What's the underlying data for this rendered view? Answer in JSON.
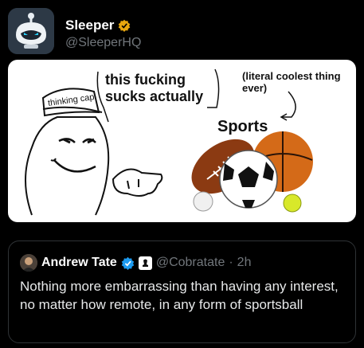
{
  "post": {
    "author_name": "Sleeper",
    "author_handle": "@SleeperHQ"
  },
  "meme": {
    "cap_text": "thinking cap",
    "speech_line1": "this fucking",
    "speech_line2": "sucks actually",
    "comment": "(literal coolest thing ever)",
    "sports_label": "Sports"
  },
  "quoted": {
    "author_name": "Andrew Tate",
    "author_handle": "@Cobratate",
    "separator": "·",
    "time": "2h",
    "text": "Nothing more embarrassing than having any interest, no matter how remote, in any form of sportsball"
  },
  "colors": {
    "background": "#000000",
    "verified_gold": "#e8a70f",
    "verified_blue": "#1d9bf0",
    "muted": "#71767b",
    "border": "#2f3336"
  }
}
